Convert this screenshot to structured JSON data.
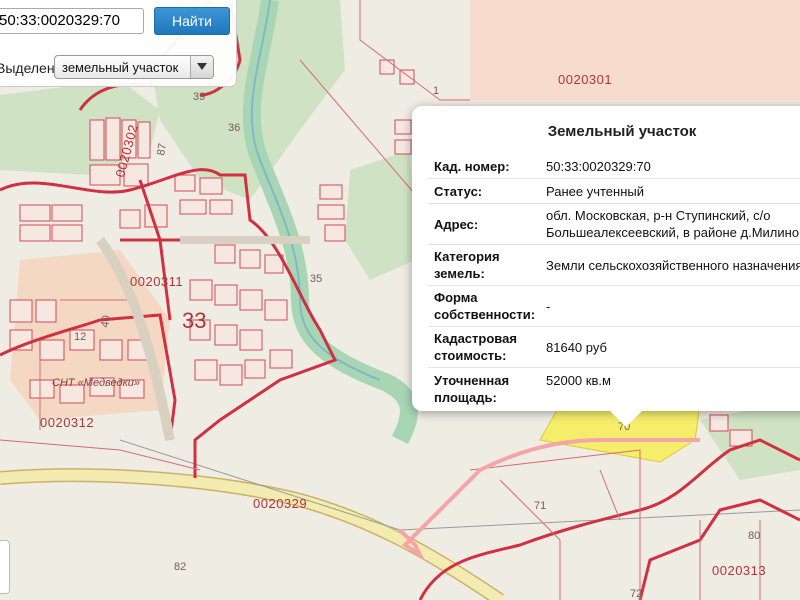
{
  "search": {
    "query": "50:33:0020329:70",
    "find_label": "Найти",
    "layer_label": "Выделение:",
    "layer_value": "земельный участок"
  },
  "popup": {
    "title": "Земельный участок",
    "rows": [
      {
        "key": "Кад. номер:",
        "value": "50:33:0020329:70"
      },
      {
        "key": "Статус:",
        "value": "Ранее учтенный"
      },
      {
        "key": "Адрес:",
        "value": "обл. Московская, р-н Ступинский, с/о Большеалексеевский, в районе д.Милино"
      },
      {
        "key": "Категория земель:",
        "value": "Земли сельскохозяйственного назначения"
      },
      {
        "key": "Форма собственности:",
        "value": "-"
      },
      {
        "key": "Кадастровая стоимость:",
        "value": "81640 руб"
      },
      {
        "key": "Уточненная площадь:",
        "value": "52000 кв.м"
      }
    ]
  },
  "map": {
    "quarters": [
      "0020301",
      "0020302",
      "0020311",
      "0020312",
      "0020329",
      "0020313"
    ],
    "big_number": "33",
    "snt_label": "СНТ «Медведки»",
    "parcel_numbers": [
      "1",
      "39",
      "36",
      "87",
      "35",
      "40",
      "12",
      "70",
      "71",
      "80",
      "82",
      "72"
    ],
    "colors": {
      "boundary": "#d03040",
      "selected_parcel": "#f6ee6a",
      "forest": "#cfe3c4",
      "road": "#f3ebb0",
      "river": "#9fd0ad",
      "field": "#f7dccb"
    }
  }
}
